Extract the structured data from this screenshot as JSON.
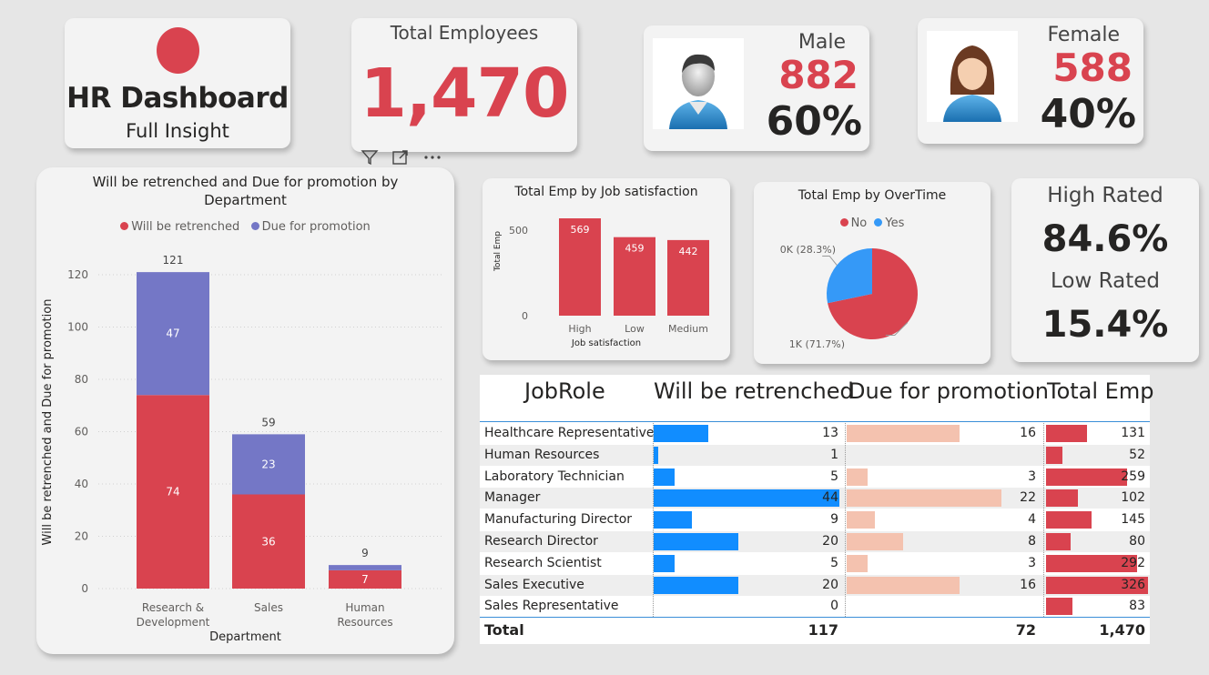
{
  "header": {
    "title": "HR Dashboard",
    "subtitle": "Full Insight",
    "total_label": "Total Employees",
    "total_value": "1,470"
  },
  "male": {
    "label": "Male",
    "count": "882",
    "percent": "60%"
  },
  "female": {
    "label": "Female",
    "count": "588",
    "percent": "40%"
  },
  "rating": {
    "high_label": "High Rated",
    "high_value": "84.6%",
    "low_label": "Low Rated",
    "low_value": "15.4%"
  },
  "colors": {
    "red": "#d9434f",
    "purple": "#7477c6",
    "blue": "#118dff",
    "blue_light": "#3599f7",
    "salmon": "#f4c2af"
  },
  "icons": [
    "filter-icon",
    "focus-mode-icon",
    "more-options-icon",
    "male-avatar-icon",
    "female-avatar-icon"
  ],
  "chart_data": [
    {
      "id": "dept",
      "type": "bar",
      "stacked": true,
      "title": "Will be retrenched and Due for promotion by Department",
      "xlabel": "Department",
      "ylabel": "Will be retrenched and Due for promotion",
      "categories": [
        "Research & Development",
        "Sales",
        "Human Resources"
      ],
      "category_lines": [
        [
          "Research &",
          "Development"
        ],
        [
          "Sales"
        ],
        [
          "Human",
          "Resources"
        ]
      ],
      "series": [
        {
          "name": "Will be retrenched",
          "values": [
            74,
            36,
            7
          ]
        },
        {
          "name": "Due for promotion",
          "values": [
            47,
            23,
            2
          ]
        }
      ],
      "totals": [
        121,
        59,
        9
      ],
      "ylim": [
        0,
        120
      ],
      "yticks": [
        0,
        20,
        40,
        60,
        80,
        100,
        120
      ],
      "legend": "top-center",
      "grid": true
    },
    {
      "id": "jobsat",
      "type": "bar",
      "title": "Total Emp by Job satisfaction",
      "xlabel": "Job satisfaction",
      "ylabel": "Total Emp",
      "categories": [
        "High",
        "Low",
        "Medium"
      ],
      "values": [
        569,
        459,
        442
      ],
      "yticks": [
        0,
        500
      ],
      "ylim": [
        0,
        569
      ]
    },
    {
      "id": "overtime",
      "type": "pie",
      "title": "Total Emp by OverTime",
      "labels": [
        "No",
        "Yes"
      ],
      "values": [
        1054,
        416
      ],
      "data_labels": [
        "1K (71.7%)",
        "0K (28.3%)"
      ],
      "legend": "top-center"
    },
    {
      "id": "jobrole",
      "type": "table",
      "columns": [
        "JobRole",
        "Will be retrenched",
        "Due for promotion",
        "Total Emp"
      ],
      "rows": [
        {
          "role": "Healthcare Representative",
          "retrenched": 13,
          "promotion": 16,
          "total": 131
        },
        {
          "role": "Human Resources",
          "retrenched": 1,
          "promotion": null,
          "total": 52
        },
        {
          "role": "Laboratory Technician",
          "retrenched": 5,
          "promotion": 3,
          "total": 259
        },
        {
          "role": "Manager",
          "retrenched": 44,
          "promotion": 22,
          "total": 102
        },
        {
          "role": "Manufacturing Director",
          "retrenched": 9,
          "promotion": 4,
          "total": 145
        },
        {
          "role": "Research Director",
          "retrenched": 20,
          "promotion": 8,
          "total": 80
        },
        {
          "role": "Research Scientist",
          "retrenched": 5,
          "promotion": 3,
          "total": 292
        },
        {
          "role": "Sales Executive",
          "retrenched": 20,
          "promotion": 16,
          "total": 326
        },
        {
          "role": "Sales Representative",
          "retrenched": 0,
          "promotion": null,
          "total": 83
        }
      ],
      "total_label": "Total",
      "totals": {
        "retrenched": "117",
        "promotion": "72",
        "total": "1,470"
      }
    }
  ]
}
